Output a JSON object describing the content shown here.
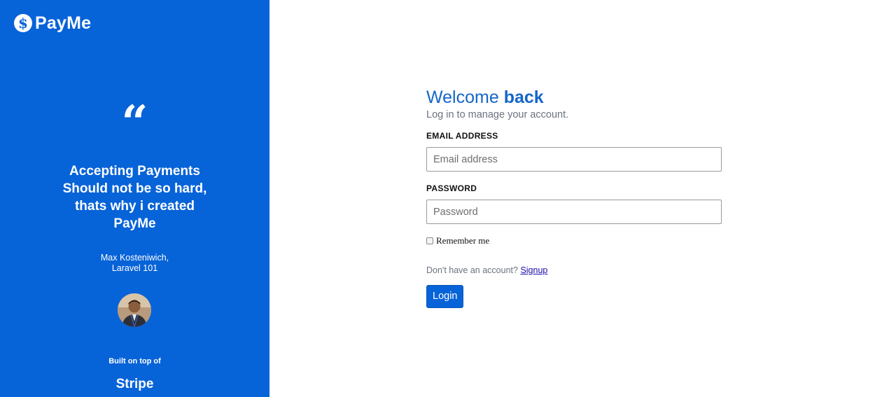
{
  "brand": {
    "name": "PayMe",
    "icon": "dollar-coin-icon",
    "icon_glyph": "$"
  },
  "testimonial": {
    "quote_glyph": "“",
    "lines": [
      "Accepting Payments",
      "Should not be so hard,",
      "thats why i created",
      "PayMe"
    ],
    "author_name": "Max Kosteniwich,",
    "author_role": "Laravel 101"
  },
  "footer": {
    "built_on": "Built on top of",
    "platform": "Stripe"
  },
  "login": {
    "title_regular": "Welcome ",
    "title_bold": "back",
    "subtitle": "Log in to manage your account.",
    "email_label": "EMAIL ADDRESS",
    "email_placeholder": "Email address",
    "email_value": "",
    "password_label": "PASSWORD",
    "password_placeholder": "Password",
    "password_value": "",
    "remember_label": "Remember me",
    "remember_checked": false,
    "signup_prompt": "Don't have an account?",
    "signup_link": "Signup",
    "login_button": "Login"
  },
  "colors": {
    "brand_blue": "#0763d8",
    "title_blue": "#1466c8",
    "muted_text": "#6b7280",
    "link": "#1a0dab"
  }
}
